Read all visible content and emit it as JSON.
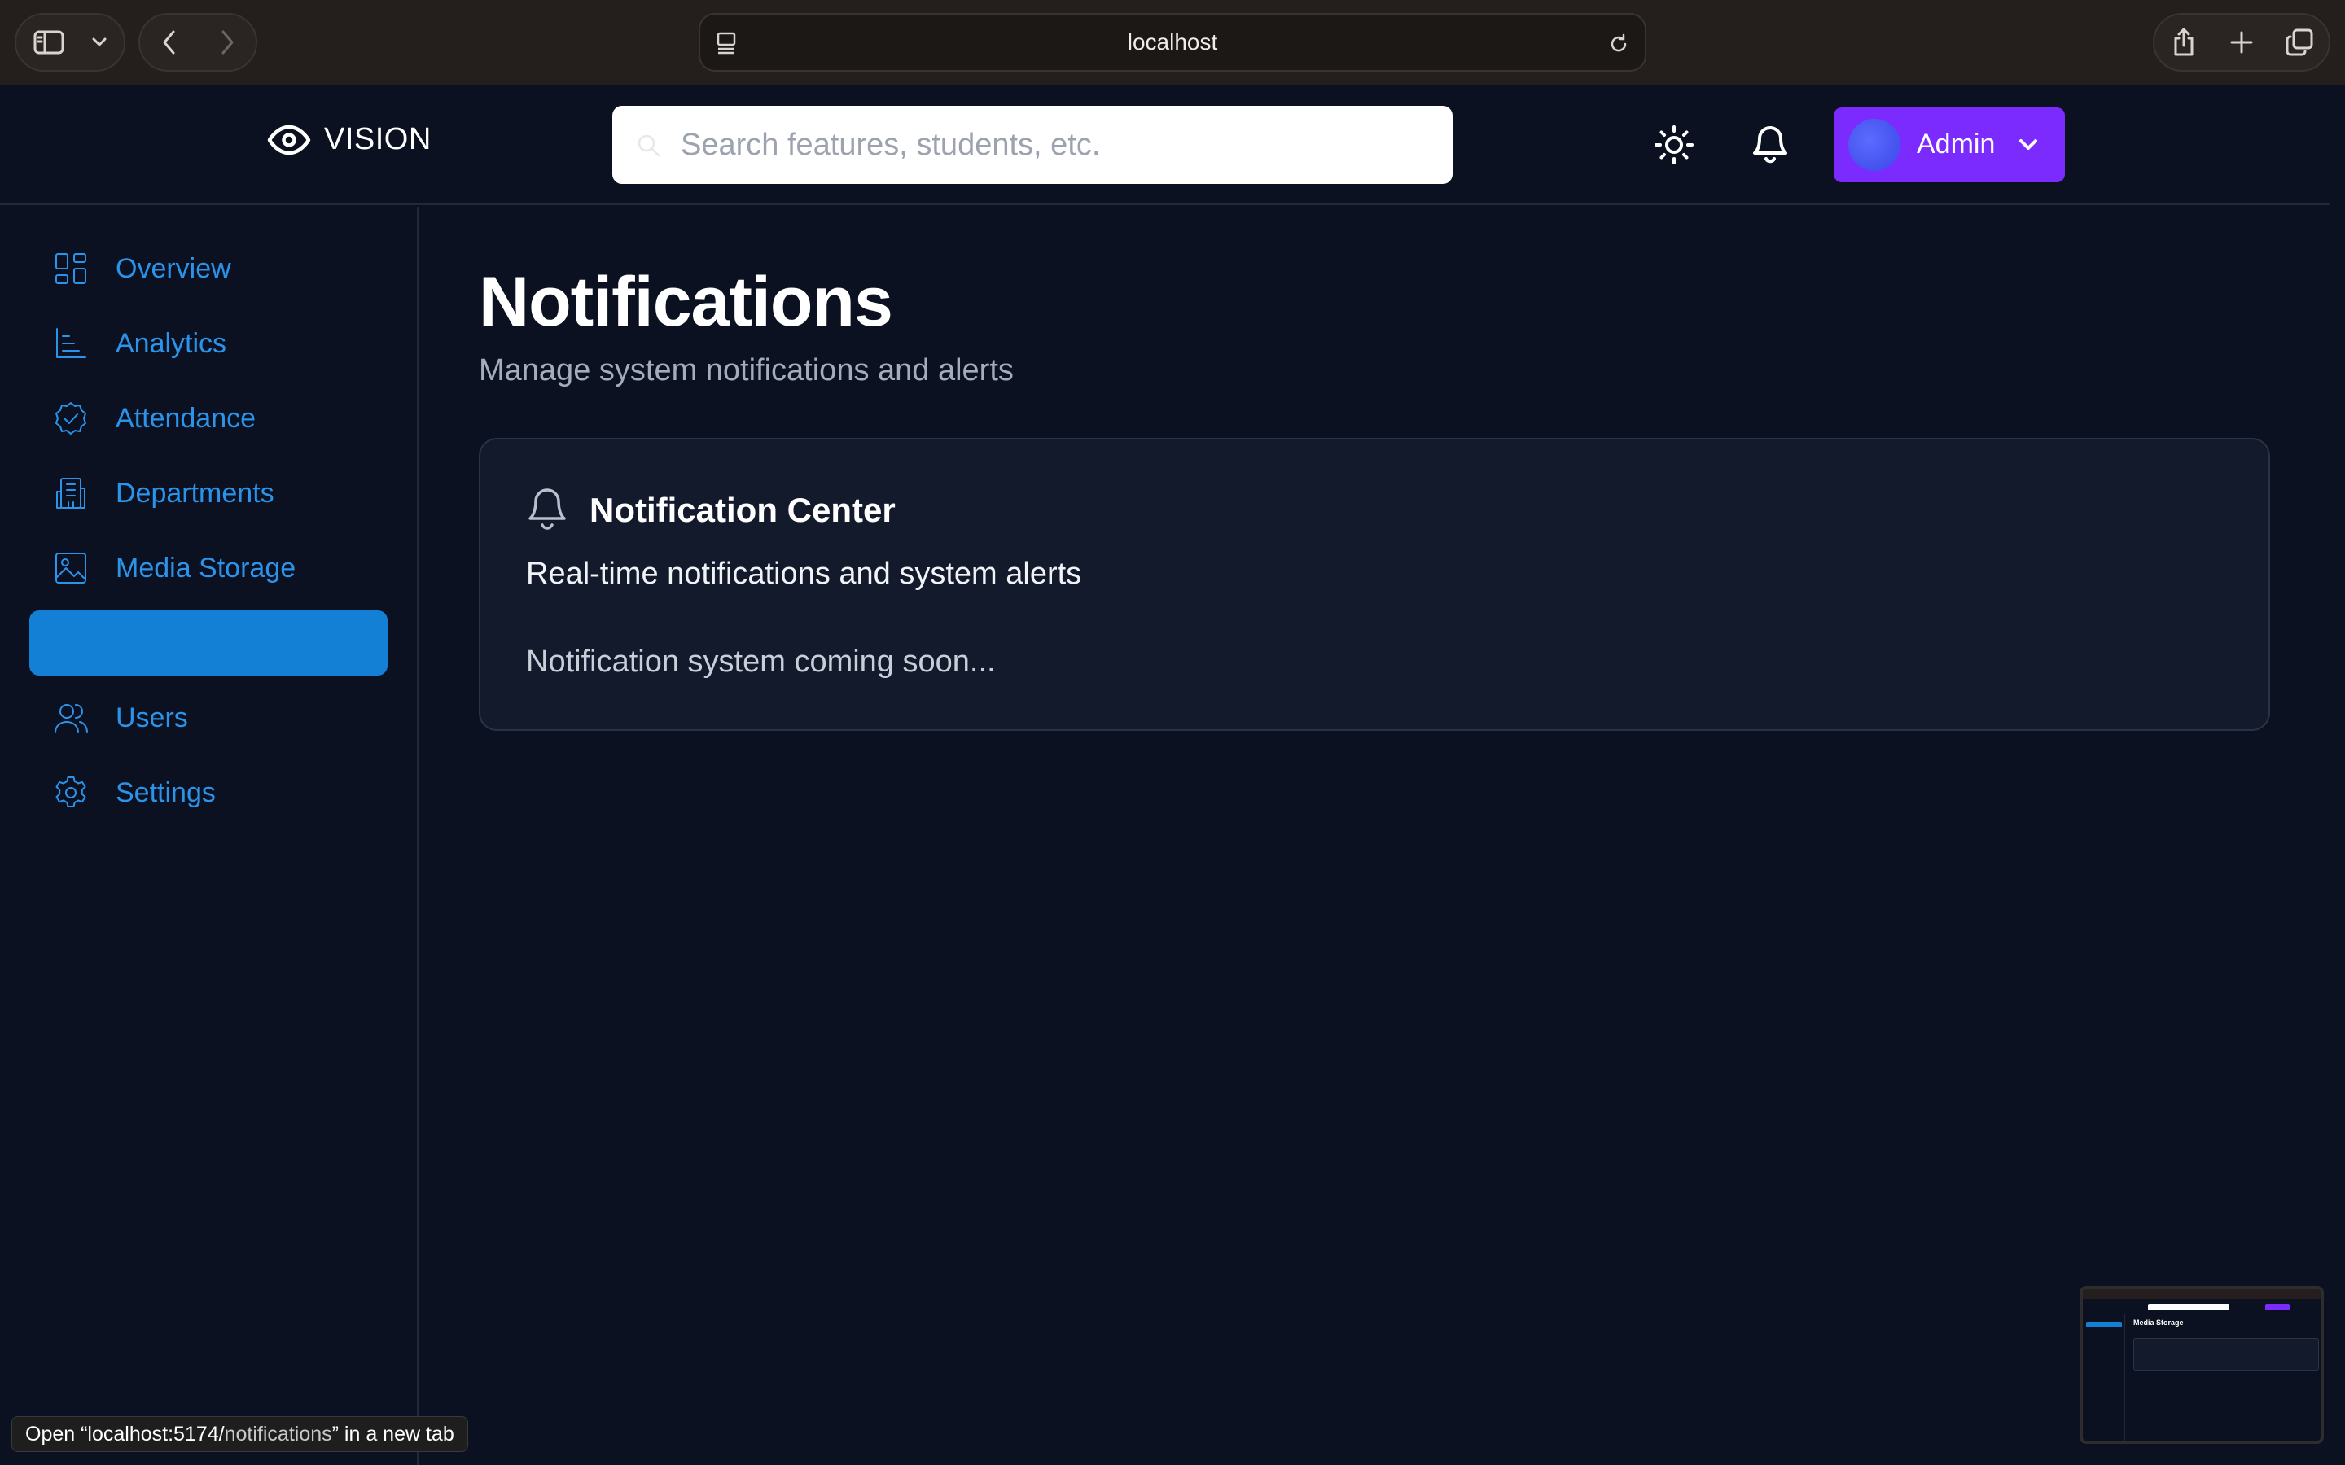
{
  "browser": {
    "url": "localhost",
    "status_prefix": "Open “localhost:5174/",
    "status_path": "notifications",
    "status_suffix": "” in a new tab"
  },
  "header": {
    "logo_text": "VISION",
    "search_placeholder": "Search features, students, etc.",
    "user_name": "Admin",
    "accent_color": "#7c2bff"
  },
  "sidebar": {
    "items": [
      {
        "label": "Overview",
        "icon": "dashboard-icon"
      },
      {
        "label": "Analytics",
        "icon": "bar-chart-icon"
      },
      {
        "label": "Attendance",
        "icon": "badge-check-icon"
      },
      {
        "label": "Departments",
        "icon": "building-icon"
      },
      {
        "label": "Media Storage",
        "icon": "image-icon"
      },
      {
        "label": "",
        "icon": "bell-icon",
        "active": true
      },
      {
        "label": "Users",
        "icon": "users-icon"
      },
      {
        "label": "Settings",
        "icon": "gear-icon"
      }
    ],
    "link_color": "#2b93ea",
    "active_color": "#1380d6"
  },
  "main": {
    "title": "Notifications",
    "subtitle": "Manage system notifications and alerts",
    "card": {
      "title": "Notification Center",
      "description": "Real-time notifications and system alerts",
      "body": "Notification system coming soon..."
    }
  },
  "thumbnail": {
    "title": "Media Storage"
  }
}
